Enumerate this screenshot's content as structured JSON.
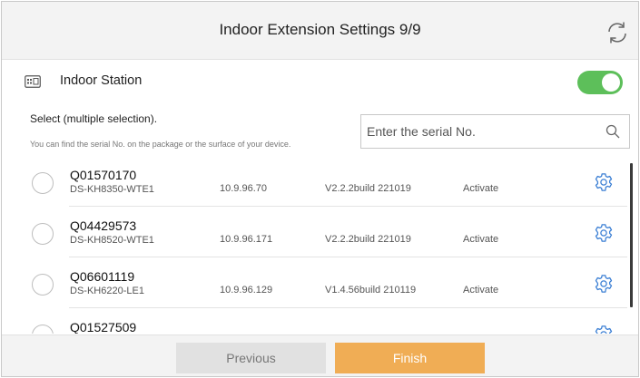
{
  "header": {
    "title": "Indoor Extension Settings 9/9"
  },
  "station": {
    "label": "Indoor Station",
    "enabled": true
  },
  "selection": {
    "label": "Select (multiple selection).",
    "hint": "You can find the serial No. on the package or the surface of your device."
  },
  "search": {
    "placeholder": "Enter the serial No.",
    "value": ""
  },
  "devices": [
    {
      "serial": "Q01570170",
      "model": "DS-KH8350-WTE1",
      "ip": "10.9.96.70",
      "version": "V2.2.2build 221019",
      "status": "Activate"
    },
    {
      "serial": "Q04429573",
      "model": "DS-KH8520-WTE1",
      "ip": "10.9.96.171",
      "version": "V2.2.2build 221019",
      "status": "Activate"
    },
    {
      "serial": "Q06601119",
      "model": "DS-KH6220-LE1",
      "ip": "10.9.96.129",
      "version": "V1.4.56build 210119",
      "status": "Activate"
    },
    {
      "serial": "Q01527509",
      "model": "",
      "ip": "",
      "version": "",
      "status": ""
    }
  ],
  "footer": {
    "previous_label": "Previous",
    "finish_label": "Finish"
  },
  "colors": {
    "toggle_on": "#5dbf5a",
    "gear": "#3b7fd4",
    "finish": "#f0ad55",
    "previous": "#e1e1e1"
  }
}
